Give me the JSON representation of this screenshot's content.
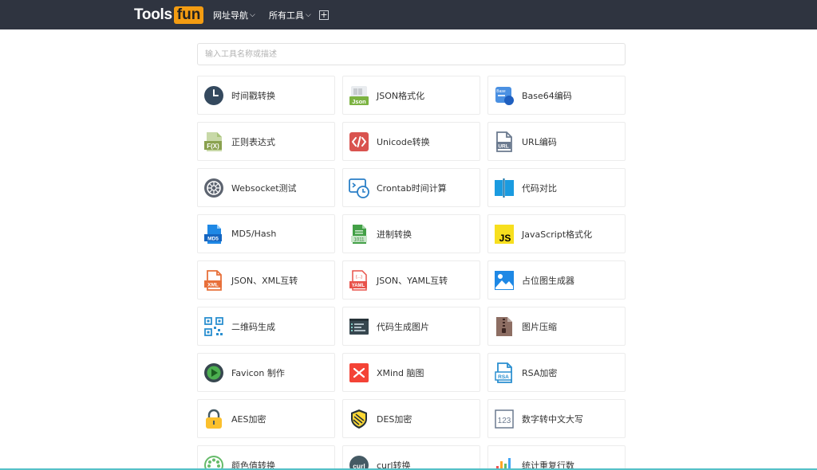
{
  "header": {
    "logo_part1": "Tools",
    "logo_part2": "fun",
    "nav": [
      {
        "label": "网址导航",
        "chevron": "⌵"
      },
      {
        "label": "所有工具",
        "chevron": "⌵"
      }
    ],
    "plus": "+"
  },
  "search": {
    "placeholder": "输入工具名称或描述",
    "value": ""
  },
  "tools": [
    {
      "label": "时间戳转换",
      "icon": "clock-icon"
    },
    {
      "label": "JSON格式化",
      "icon": "json-file-icon"
    },
    {
      "label": "Base64编码",
      "icon": "base64-icon"
    },
    {
      "label": "正则表达式",
      "icon": "regex-fx-icon"
    },
    {
      "label": "Unicode转换",
      "icon": "code-brackets-icon"
    },
    {
      "label": "URL编码",
      "icon": "url-file-icon"
    },
    {
      "label": "Websocket测试",
      "icon": "websocket-icon"
    },
    {
      "label": "Crontab时间计算",
      "icon": "crontab-terminal-icon"
    },
    {
      "label": "代码对比",
      "icon": "code-compare-icon"
    },
    {
      "label": "MD5/Hash",
      "icon": "md5-file-icon"
    },
    {
      "label": "进制转换",
      "icon": "binary-file-icon"
    },
    {
      "label": "JavaScript格式化",
      "icon": "javascript-icon"
    },
    {
      "label": "JSON、XML互转",
      "icon": "xml-file-icon"
    },
    {
      "label": "JSON、YAML互转",
      "icon": "yaml-file-icon"
    },
    {
      "label": "占位图生成器",
      "icon": "image-placeholder-icon"
    },
    {
      "label": "二维码生成",
      "icon": "qrcode-icon"
    },
    {
      "label": "代码生成图片",
      "icon": "code-image-icon"
    },
    {
      "label": "图片压缩",
      "icon": "zip-archive-icon"
    },
    {
      "label": "Favicon 制作",
      "icon": "favicon-icon"
    },
    {
      "label": "XMind 脑图",
      "icon": "xmind-icon"
    },
    {
      "label": "RSA加密",
      "icon": "rsa-file-icon"
    },
    {
      "label": "AES加密",
      "icon": "padlock-icon"
    },
    {
      "label": "DES加密",
      "icon": "des-shield-icon"
    },
    {
      "label": "数字转中文大写",
      "icon": "number-123-icon"
    },
    {
      "label": "颜色值转换",
      "icon": "color-palette-icon"
    },
    {
      "label": "curl转换",
      "icon": "curl-icon"
    },
    {
      "label": "统计重复行数",
      "icon": "bar-chart-icon"
    }
  ],
  "icon_text": {
    "json": "Json",
    "fx": "F(X)",
    "url": "URL",
    "md5": "MD5",
    "bin": "1011",
    "js": "JS",
    "xml": "XML",
    "yaml": "YAML",
    "yamlbrace": "{...}",
    "rsa": "RSA",
    "num": "123",
    "curl": "curl",
    "b64": "Base"
  },
  "colors": {
    "header_bg": "#2f3440",
    "logo_accent": "#f39c12",
    "accent_bottom": "#55c1c8"
  }
}
